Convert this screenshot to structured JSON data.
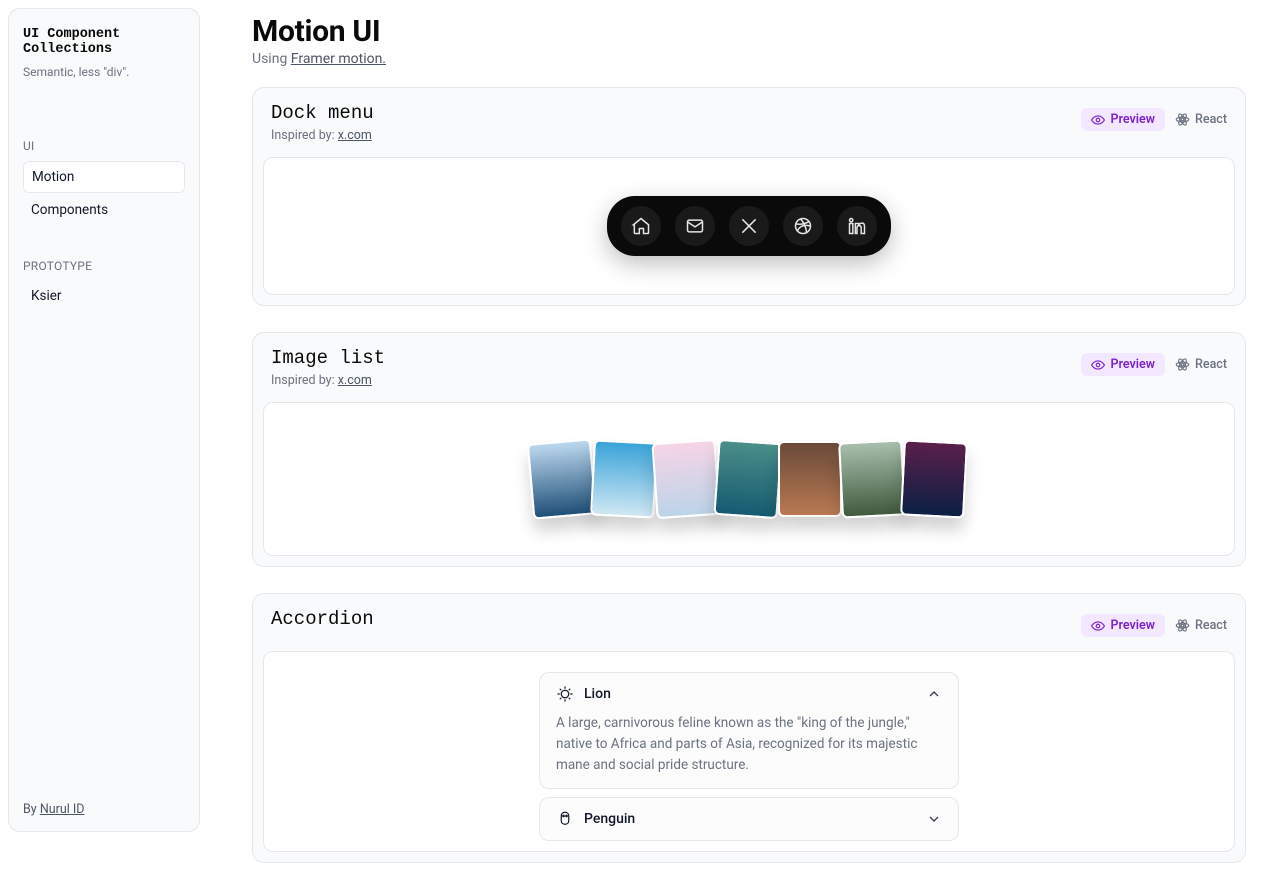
{
  "sidebar": {
    "title": "UI Component Collections",
    "subtitle": "Semantic, less \"div\".",
    "sections": [
      {
        "label": "UI",
        "items": [
          {
            "label": "Motion",
            "active": true
          },
          {
            "label": "Components",
            "active": false
          }
        ]
      },
      {
        "label": "PROTOTYPE",
        "items": [
          {
            "label": "Ksier",
            "active": false
          }
        ]
      }
    ],
    "footer_prefix": "By ",
    "footer_link": "Nurul ID"
  },
  "page": {
    "title": "Motion UI",
    "subtitle_prefix": "Using ",
    "subtitle_link": "Framer motion."
  },
  "tabs": {
    "preview": "Preview",
    "react": "React"
  },
  "inspired_prefix": "Inspired by: ",
  "inspired_link": "x.com",
  "cards": {
    "dock": {
      "title": "Dock menu",
      "icons": [
        "home",
        "mail",
        "x",
        "dribbble",
        "linkedin"
      ]
    },
    "imagelist": {
      "title": "Image list",
      "images": [
        "mountain1",
        "clouds",
        "pink-snow",
        "lake",
        "cabin",
        "meadow",
        "sunset"
      ]
    },
    "accordion": {
      "title": "Accordion",
      "items": [
        {
          "name": "Lion",
          "expanded": true,
          "content": "A large, carnivorous feline known as the \"king of the jungle,\" native to Africa and parts of Asia, recognized for its majestic mane and social pride structure."
        },
        {
          "name": "Penguin",
          "expanded": false
        }
      ]
    }
  }
}
